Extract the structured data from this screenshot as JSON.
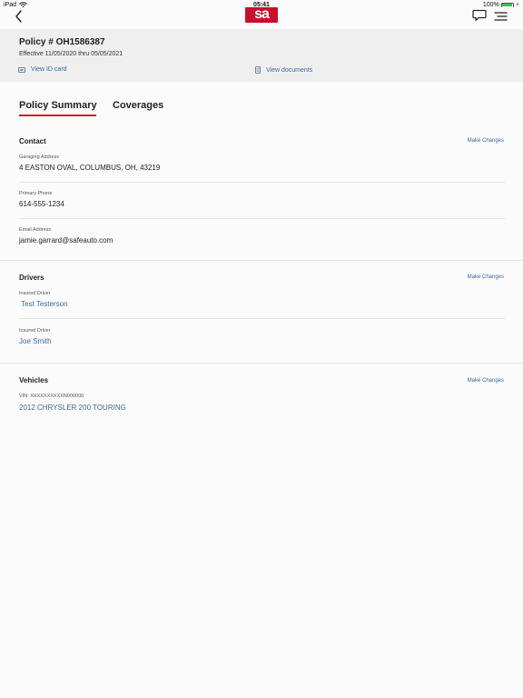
{
  "status_bar": {
    "device": "iPad",
    "time": "05:41",
    "battery": "100%"
  },
  "colors": {
    "brand": "#c8102e",
    "link": "#3a6b9a",
    "header_bg": "#efefef"
  },
  "nav": {
    "logo_text": "sa",
    "icons": [
      "chevron-left-icon",
      "chat-icon",
      "menu-icon"
    ]
  },
  "policy": {
    "number": "Policy # OH1586387",
    "effective": "Effective 11/05/2020 thru 05/05/2021",
    "view_id_card": "View ID card",
    "view_documents": "View documents"
  },
  "tabs": [
    {
      "label": "Policy Summary",
      "active": true
    },
    {
      "label": "Coverages",
      "active": false
    }
  ],
  "contact": {
    "title": "Contact",
    "make_changes": "Make Changes",
    "fields": [
      {
        "label": "Garaging Address",
        "value": "4 EASTON OVAL, COLUMBUS, OH, 43219"
      },
      {
        "label": "Primary Phone",
        "value": "614-555-1234"
      },
      {
        "label": "Email Address",
        "value": "jamie.garrard@safeauto.com"
      }
    ]
  },
  "drivers": {
    "title": "Drivers",
    "make_changes": "Make Changes",
    "items": [
      {
        "label": "Insured Driver",
        "name": " Test Testerson"
      },
      {
        "label": "Insured Driver",
        "name": "Joe Smith"
      }
    ]
  },
  "vehicles": {
    "title": "Vehicles",
    "make_changes": "Make Changes",
    "items": [
      {
        "vin": "VIN: XXXXXXXXXXN000000",
        "name": "2012 CHRYSLER 200 TOURING"
      }
    ]
  }
}
